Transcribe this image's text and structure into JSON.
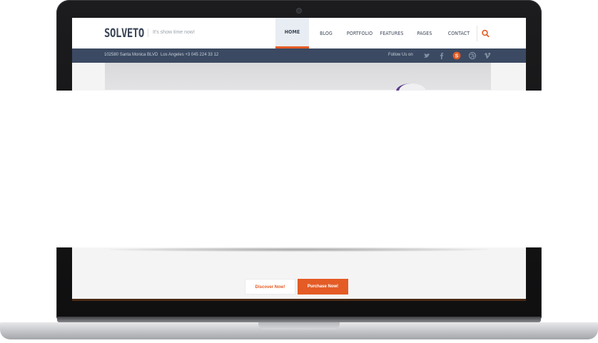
{
  "site": {
    "logo": "SOLVETO",
    "tagline": "It's show time now!",
    "nav": [
      "HOME",
      "BLOG",
      "PORTFOLIO",
      "FEATURES",
      "PAGES",
      "CONTACT"
    ],
    "active_nav": "HOME",
    "address": "102580 Santa Monica BLVD",
    "phone": "Los Angeles +3 045 224 33 12",
    "follow_label": "Follow Us on",
    "social_icons": [
      "twitter-icon",
      "facebook-icon",
      "skype-icon",
      "dribbble-icon",
      "vimeo-icon"
    ],
    "buttons": {
      "discover": "Discover Now!",
      "purchase": "Purchase Now!"
    }
  },
  "colors": {
    "accent": "#e45b25",
    "navy": "#3b4a62",
    "text": "#3b4557"
  }
}
